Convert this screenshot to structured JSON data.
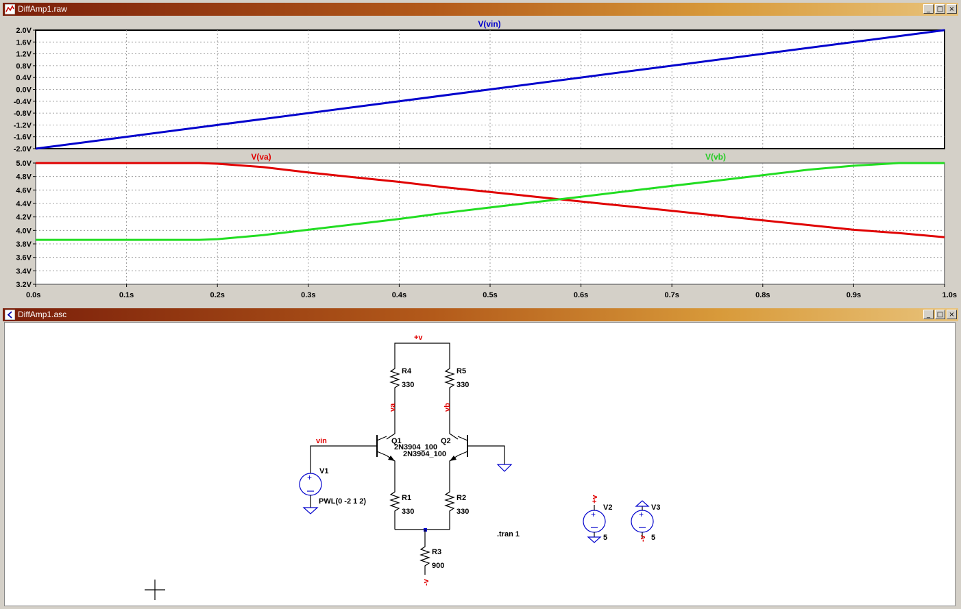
{
  "waveform_window": {
    "title": "DiffAmp1.raw",
    "buttons": [
      "_",
      "□",
      "×"
    ],
    "top_pane": {
      "trace_label": "V(vin)",
      "y_ticks": [
        "2.0V",
        "1.6V",
        "1.2V",
        "0.8V",
        "0.4V",
        "0.0V",
        "-0.4V",
        "-0.8V",
        "-1.2V",
        "-1.6V",
        "-2.0V"
      ]
    },
    "bottom_pane": {
      "trace_labels": [
        "V(va)",
        "V(vb)"
      ],
      "y_ticks": [
        "5.0V",
        "4.8V",
        "4.6V",
        "4.4V",
        "4.2V",
        "4.0V",
        "3.8V",
        "3.6V",
        "3.4V",
        "3.2V"
      ]
    },
    "x_ticks": [
      "0.0s",
      "0.1s",
      "0.2s",
      "0.3s",
      "0.4s",
      "0.5s",
      "0.6s",
      "0.7s",
      "0.8s",
      "0.9s",
      "1.0s"
    ],
    "colors": {
      "vin": "#0000cc",
      "va": "#e00000",
      "vb": "#22dd22"
    }
  },
  "chart_data": [
    {
      "type": "line",
      "title": "V(vin)",
      "xlabel": "",
      "ylabel": "",
      "xlim": [
        0,
        1
      ],
      "ylim": [
        -2,
        2
      ],
      "grid": true,
      "series": [
        {
          "name": "V(vin)",
          "x": [
            0,
            1
          ],
          "y": [
            -2.0,
            2.0
          ]
        }
      ]
    },
    {
      "type": "line",
      "title": "",
      "xlabel": "",
      "ylabel": "",
      "xlim": [
        0,
        1
      ],
      "ylim": [
        3.2,
        5.0
      ],
      "grid": true,
      "series": [
        {
          "name": "V(va)",
          "x": [
            0,
            0.1,
            0.18,
            0.2,
            0.25,
            0.3,
            0.35,
            0.4,
            0.45,
            0.5,
            0.55,
            0.6,
            0.65,
            0.7,
            0.75,
            0.8,
            0.85,
            0.9,
            0.95,
            1.0
          ],
          "y": [
            5.0,
            5.0,
            5.0,
            4.99,
            4.94,
            4.86,
            4.79,
            4.72,
            4.64,
            4.57,
            4.5,
            4.43,
            4.36,
            4.29,
            4.22,
            4.15,
            4.08,
            4.01,
            3.96,
            3.9
          ]
        },
        {
          "name": "V(vb)",
          "x": [
            0,
            0.1,
            0.18,
            0.2,
            0.25,
            0.3,
            0.35,
            0.4,
            0.45,
            0.5,
            0.55,
            0.6,
            0.65,
            0.7,
            0.75,
            0.8,
            0.85,
            0.9,
            0.95,
            1.0
          ],
          "y": [
            3.86,
            3.86,
            3.86,
            3.87,
            3.93,
            4.01,
            4.09,
            4.17,
            4.26,
            4.34,
            4.42,
            4.5,
            4.58,
            4.66,
            4.74,
            4.82,
            4.9,
            4.96,
            5.0,
            5.0
          ]
        }
      ]
    }
  ],
  "schematic_window": {
    "title": "DiffAmp1.asc",
    "buttons": [
      "_",
      "□",
      "×"
    ],
    "labels": {
      "plus_v": "+v",
      "va": "va",
      "vb": "vb",
      "vin": "vin",
      "r4": "R4",
      "r4_val": "330",
      "r5": "R5",
      "r5_val": "330",
      "q1": "Q1",
      "q1_model": "2N3904_100",
      "q2": "Q2",
      "q2_model": "2N3904_100",
      "r1": "R1",
      "r1_val": "330",
      "r2": "R2",
      "r2_val": "330",
      "r3": "R3",
      "r3_val": "900",
      "minus_v": "-v",
      "v1": "V1",
      "v1_val": "PWL(0 -2 1 2)",
      "v2": "V2",
      "v2_val": "5",
      "v2_net": "+v",
      "v3": "V3",
      "v3_val": "5",
      "v3_net": "-v",
      "tran": ".tran 1"
    }
  }
}
